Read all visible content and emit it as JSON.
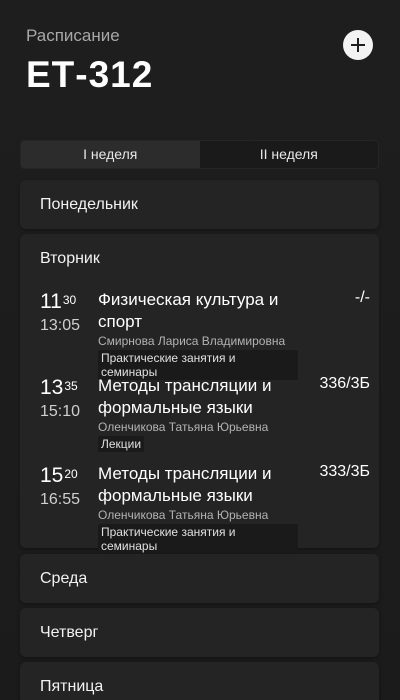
{
  "header": {
    "caption": "Расписание",
    "group": "ЕТ-312"
  },
  "tabs": [
    {
      "label": "I неделя",
      "active": true
    },
    {
      "label": "II неделя",
      "active": false
    }
  ],
  "days": {
    "mon": {
      "name": "Понедельник"
    },
    "tue": {
      "name": "Вторник",
      "lessons": [
        {
          "start_h": "11",
          "start_m": "30",
          "end": "13:05",
          "subject": "Физическая культура и спорт",
          "room": "-/-",
          "teacher": "Смирнова Лариса Владимировна",
          "type": "Практические занятия и семинары"
        },
        {
          "start_h": "13",
          "start_m": "35",
          "end": "15:10",
          "subject": "Методы трансляции и формальные языки",
          "room": "336/3Б",
          "teacher": "Оленчикова Татьяна Юрьевна",
          "type": "Лекции"
        },
        {
          "start_h": "15",
          "start_m": "20",
          "end": "16:55",
          "subject": "Методы трансляции и формальные языки",
          "room": "333/3Б",
          "teacher": "Оленчикова Татьяна Юрьевна",
          "type": "Практические занятия и семинары"
        }
      ]
    },
    "wed": {
      "name": "Среда"
    },
    "thu": {
      "name": "Четверг"
    },
    "fri": {
      "name": "Пятница"
    }
  },
  "icons": {
    "add": "plus-icon"
  },
  "colors": {
    "background": "#1e1e1e",
    "card": "#242424",
    "accent": "#ffffff"
  }
}
